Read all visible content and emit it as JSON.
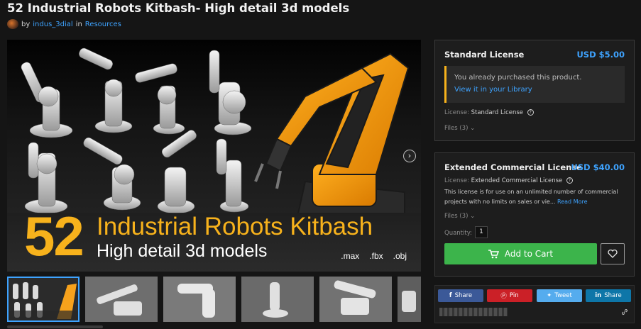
{
  "product": {
    "title": "52 Industrial Robots Kitbash- High detail 3d models",
    "by_label": "by",
    "author": "indus_3dial",
    "in_label": "in",
    "category": "Resources"
  },
  "preview": {
    "number": "52",
    "headline": "Industrial Robots Kitbash",
    "subline": "High detail 3d models",
    "formats": [
      ".max",
      ".fbx",
      ".obj"
    ],
    "accent_color": "#f7b21c",
    "next_icon": "chevron-right-icon"
  },
  "thumbnails": {
    "count_visible": 6,
    "active_index": 0
  },
  "standard_license": {
    "title": "Standard License",
    "price": "USD $5.00",
    "notice_text": "You already purchased this product.",
    "notice_link": "View it in your Library",
    "license_label": "License:",
    "license_value": "Standard License",
    "info_glyph": "?",
    "files_label": "Files (3)"
  },
  "extended_license": {
    "title": "Extended Commercial License",
    "price": "USD $40.00",
    "license_label": "License:",
    "license_value": "Extended Commercial License",
    "info_glyph": "?",
    "description": "This license is for use on an unlimited number of commercial projects with no limits on sales or vie...",
    "read_more": "Read More",
    "files_label": "Files (3)",
    "quantity_label": "Quantity:",
    "quantity_value": "1",
    "cart_label": "Add to Cart",
    "cart_color": "#3cb44b",
    "wishlist_icon": "heart-icon"
  },
  "share": {
    "buttons": [
      {
        "label": "Share",
        "icon": "facebook-icon",
        "color": "#3b5998"
      },
      {
        "label": "Pin",
        "icon": "pinterest-icon",
        "color": "#cb2027"
      },
      {
        "label": "Tweet",
        "icon": "twitter-icon",
        "color": "#55acee"
      },
      {
        "label": "Share",
        "icon": "linkedin-icon",
        "color": "#0e76a8"
      }
    ],
    "link_icon": "link-icon"
  }
}
